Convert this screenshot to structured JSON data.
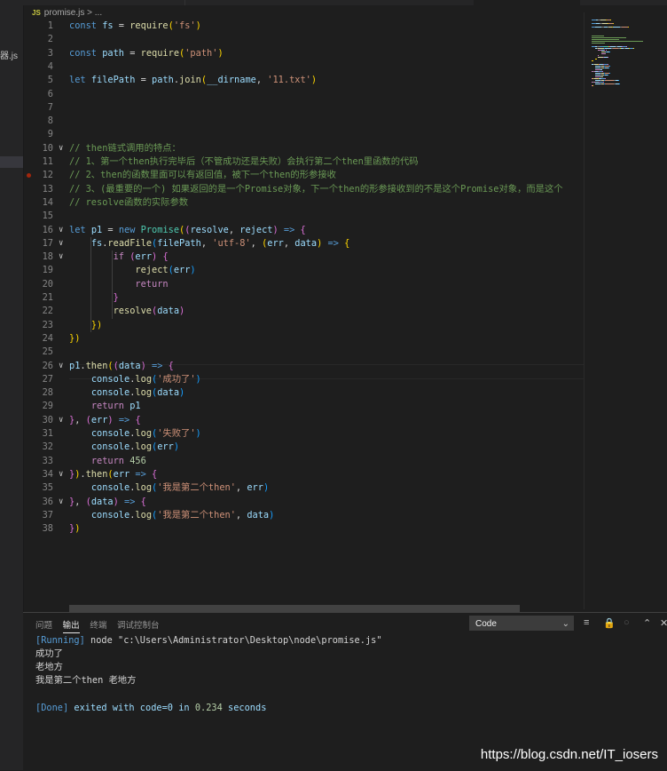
{
  "sidebar": {
    "file_fragment": "器.js"
  },
  "breadcrumb": {
    "lang_badge": "JS",
    "file": "promise.js",
    "sep": ">",
    "rest": "..."
  },
  "code_lines": [
    {
      "n": "1",
      "t": [
        [
          "kw",
          "const "
        ],
        [
          "var",
          "fs"
        ],
        [
          "pl",
          " = "
        ],
        [
          "fn",
          "require"
        ],
        [
          "b1",
          "("
        ],
        [
          "str",
          "'fs'"
        ],
        [
          "b1",
          ")"
        ]
      ]
    },
    {
      "n": "2",
      "t": []
    },
    {
      "n": "3",
      "t": [
        [
          "kw",
          "const "
        ],
        [
          "var",
          "path"
        ],
        [
          "pl",
          " = "
        ],
        [
          "fn",
          "require"
        ],
        [
          "b1",
          "("
        ],
        [
          "str",
          "'path'"
        ],
        [
          "b1",
          ")"
        ]
      ]
    },
    {
      "n": "4",
      "t": []
    },
    {
      "n": "5",
      "t": [
        [
          "kw",
          "let "
        ],
        [
          "var",
          "filePath"
        ],
        [
          "pl",
          " = "
        ],
        [
          "var",
          "path"
        ],
        [
          "pl",
          "."
        ],
        [
          "fn",
          "join"
        ],
        [
          "b1",
          "("
        ],
        [
          "var",
          "__dirname"
        ],
        [
          "pl",
          ", "
        ],
        [
          "str",
          "'11.txt'"
        ],
        [
          "b1",
          ")"
        ]
      ]
    },
    {
      "n": "6",
      "t": []
    },
    {
      "n": "7",
      "t": []
    },
    {
      "n": "8",
      "t": []
    },
    {
      "n": "9",
      "t": []
    },
    {
      "n": "10",
      "t": [
        [
          "cmt",
          "// then链式调用的特点："
        ]
      ]
    },
    {
      "n": "11",
      "t": [
        [
          "cmt",
          "// 1、第一个then执行完毕后（不管成功还是失败）会执行第二个then里函数的代码"
        ]
      ]
    },
    {
      "n": "12",
      "t": [
        [
          "cmt",
          "// 2、then的函数里面可以有返回值，被下一个then的形参接收"
        ]
      ]
    },
    {
      "n": "13",
      "t": [
        [
          "cmt",
          "// 3、(最重要的一个) 如果返回的是一个Promise对象，下一个then的形参接收到的不是这个Promise对象，而是这个"
        ]
      ]
    },
    {
      "n": "14",
      "t": [
        [
          "cmt",
          "// resolve函数的实际参数"
        ]
      ]
    },
    {
      "n": "15",
      "t": []
    },
    {
      "n": "16",
      "t": [
        [
          "kw",
          "let "
        ],
        [
          "var",
          "p1"
        ],
        [
          "pl",
          " = "
        ],
        [
          "kw",
          "new "
        ],
        [
          "cls",
          "Promise"
        ],
        [
          "b1",
          "("
        ],
        [
          "b2",
          "("
        ],
        [
          "var",
          "resolve"
        ],
        [
          "pl",
          ", "
        ],
        [
          "var",
          "reject"
        ],
        [
          "b2",
          ")"
        ],
        [
          "kw",
          " => "
        ],
        [
          "b2",
          "{"
        ]
      ]
    },
    {
      "n": "17",
      "t": [
        [
          "pl",
          "    "
        ],
        [
          "var",
          "fs"
        ],
        [
          "pl",
          "."
        ],
        [
          "fn",
          "readFile"
        ],
        [
          "b3",
          "("
        ],
        [
          "var",
          "filePath"
        ],
        [
          "pl",
          ", "
        ],
        [
          "str",
          "'utf-8'"
        ],
        [
          "pl",
          ", "
        ],
        [
          "b1",
          "("
        ],
        [
          "var",
          "err"
        ],
        [
          "pl",
          ", "
        ],
        [
          "var",
          "data"
        ],
        [
          "b1",
          ")"
        ],
        [
          "kw",
          " => "
        ],
        [
          "b1",
          "{"
        ]
      ]
    },
    {
      "n": "18",
      "t": [
        [
          "pl",
          "        "
        ],
        [
          "kw2",
          "if "
        ],
        [
          "b2",
          "("
        ],
        [
          "var",
          "err"
        ],
        [
          "b2",
          ")"
        ],
        [
          "pl",
          " "
        ],
        [
          "b2",
          "{"
        ]
      ]
    },
    {
      "n": "19",
      "t": [
        [
          "pl",
          "            "
        ],
        [
          "fn",
          "reject"
        ],
        [
          "b3",
          "("
        ],
        [
          "var",
          "err"
        ],
        [
          "b3",
          ")"
        ]
      ]
    },
    {
      "n": "20",
      "t": [
        [
          "pl",
          "            "
        ],
        [
          "kw2",
          "return"
        ]
      ]
    },
    {
      "n": "21",
      "t": [
        [
          "pl",
          "        "
        ],
        [
          "b2",
          "}"
        ]
      ]
    },
    {
      "n": "22",
      "t": [
        [
          "pl",
          "        "
        ],
        [
          "fn",
          "resolve"
        ],
        [
          "b2",
          "("
        ],
        [
          "var",
          "data"
        ],
        [
          "b2",
          ")"
        ]
      ]
    },
    {
      "n": "23",
      "t": [
        [
          "pl",
          "    "
        ],
        [
          "b1",
          "})"
        ]
      ]
    },
    {
      "n": "24",
      "t": [
        [
          "b1",
          "})"
        ]
      ]
    },
    {
      "n": "25",
      "t": []
    },
    {
      "n": "26",
      "t": [
        [
          "var",
          "p1"
        ],
        [
          "pl",
          "."
        ],
        [
          "fn",
          "then"
        ],
        [
          "b1",
          "("
        ],
        [
          "b2",
          "("
        ],
        [
          "var",
          "data"
        ],
        [
          "b2",
          ")"
        ],
        [
          "kw",
          " => "
        ],
        [
          "b2",
          "{"
        ]
      ]
    },
    {
      "n": "27",
      "t": [
        [
          "pl",
          "    "
        ],
        [
          "var",
          "console"
        ],
        [
          "pl",
          "."
        ],
        [
          "fn",
          "log"
        ],
        [
          "b3",
          "("
        ],
        [
          "str",
          "'成功了'"
        ],
        [
          "b3",
          ")"
        ]
      ]
    },
    {
      "n": "28",
      "t": [
        [
          "pl",
          "    "
        ],
        [
          "var",
          "console"
        ],
        [
          "pl",
          "."
        ],
        [
          "fn",
          "log"
        ],
        [
          "b3",
          "("
        ],
        [
          "var",
          "data"
        ],
        [
          "b3",
          ")"
        ]
      ]
    },
    {
      "n": "29",
      "t": [
        [
          "pl",
          "    "
        ],
        [
          "kw2",
          "return "
        ],
        [
          "var",
          "p1"
        ]
      ]
    },
    {
      "n": "30",
      "t": [
        [
          "b2",
          "}"
        ],
        [
          "pl",
          ", "
        ],
        [
          "b2",
          "("
        ],
        [
          "var",
          "err"
        ],
        [
          "b2",
          ")"
        ],
        [
          "kw",
          " => "
        ],
        [
          "b2",
          "{"
        ]
      ]
    },
    {
      "n": "31",
      "t": [
        [
          "pl",
          "    "
        ],
        [
          "var",
          "console"
        ],
        [
          "pl",
          "."
        ],
        [
          "fn",
          "log"
        ],
        [
          "b3",
          "("
        ],
        [
          "str",
          "'失败了'"
        ],
        [
          "b3",
          ")"
        ]
      ]
    },
    {
      "n": "32",
      "t": [
        [
          "pl",
          "    "
        ],
        [
          "var",
          "console"
        ],
        [
          "pl",
          "."
        ],
        [
          "fn",
          "log"
        ],
        [
          "b3",
          "("
        ],
        [
          "var",
          "err"
        ],
        [
          "b3",
          ")"
        ]
      ]
    },
    {
      "n": "33",
      "t": [
        [
          "pl",
          "    "
        ],
        [
          "kw2",
          "return "
        ],
        [
          "num",
          "456"
        ]
      ]
    },
    {
      "n": "34",
      "t": [
        [
          "b2",
          "}"
        ],
        [
          "b1",
          ")"
        ],
        [
          "pl",
          "."
        ],
        [
          "fn",
          "then"
        ],
        [
          "b1",
          "("
        ],
        [
          "var",
          "err"
        ],
        [
          "kw",
          " => "
        ],
        [
          "b2",
          "{"
        ]
      ]
    },
    {
      "n": "35",
      "t": [
        [
          "pl",
          "    "
        ],
        [
          "var",
          "console"
        ],
        [
          "pl",
          "."
        ],
        [
          "fn",
          "log"
        ],
        [
          "b3",
          "("
        ],
        [
          "str",
          "'我是第二个then'"
        ],
        [
          "pl",
          ", "
        ],
        [
          "var",
          "err"
        ],
        [
          "b3",
          ")"
        ]
      ]
    },
    {
      "n": "36",
      "t": [
        [
          "b2",
          "}"
        ],
        [
          "pl",
          ", "
        ],
        [
          "b2",
          "("
        ],
        [
          "var",
          "data"
        ],
        [
          "b2",
          ")"
        ],
        [
          "kw",
          " => "
        ],
        [
          "b2",
          "{"
        ]
      ]
    },
    {
      "n": "37",
      "t": [
        [
          "pl",
          "    "
        ],
        [
          "var",
          "console"
        ],
        [
          "pl",
          "."
        ],
        [
          "fn",
          "log"
        ],
        [
          "b3",
          "("
        ],
        [
          "str",
          "'我是第二个then'"
        ],
        [
          "pl",
          ", "
        ],
        [
          "var",
          "data"
        ],
        [
          "b3",
          ")"
        ]
      ]
    },
    {
      "n": "38",
      "t": [
        [
          "b2",
          "}"
        ],
        [
          "b1",
          ")"
        ]
      ]
    }
  ],
  "panel": {
    "tabs": [
      "问题",
      "输出",
      "终端",
      "调试控制台"
    ],
    "active_tab": "输出",
    "select_value": "Code",
    "output": {
      "running_tag": "[Running]",
      "running_cmd": " node \"c:\\Users\\Administrator\\Desktop\\node\\promise.js\"",
      "lines": [
        "成功了",
        "老地方",
        "我是第二个then 老地方"
      ],
      "done_tag": "[Done]",
      "done_text_1": " exited with ",
      "done_code": "code=0",
      "done_text_2": " in ",
      "done_time": "0.234",
      "done_text_3": " seconds"
    }
  },
  "watermark": "https://blog.csdn.net/IT_iosers"
}
